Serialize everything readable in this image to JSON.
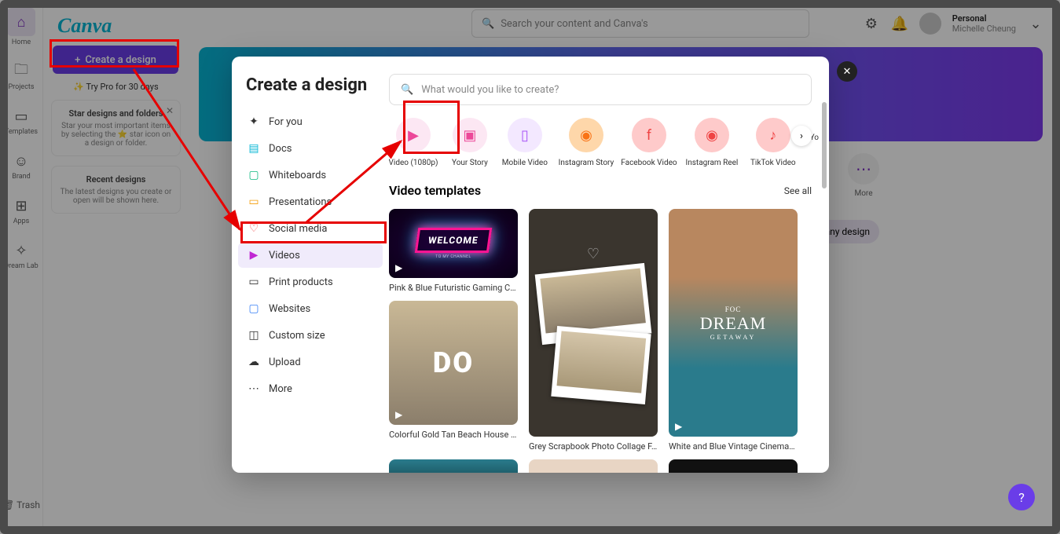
{
  "rail": {
    "items": [
      {
        "label": "Home",
        "icon": "⌂"
      },
      {
        "label": "Projects",
        "icon": "🗀"
      },
      {
        "label": "Templates",
        "icon": "▭"
      },
      {
        "label": "Brand",
        "icon": "☺"
      },
      {
        "label": "Apps",
        "icon": "⊞"
      },
      {
        "label": "Dream Lab",
        "icon": "✧"
      }
    ],
    "trash": "Trash"
  },
  "sidebar": {
    "logo": "Canva",
    "create_btn": "Create a design",
    "try_pro": "✨ Try Pro for 30 days",
    "card1_title": "Star designs and folders",
    "card1_text": "Star your most important items by selecting the ⭐ star icon on a design or folder.",
    "card2_title": "Recent designs",
    "card2_text": "The latest designs you create or open will be shown here."
  },
  "topbar": {
    "search_placeholder": "Search your content and Canva's",
    "personal": "Personal",
    "username": "Michelle Cheung"
  },
  "behind": {
    "more": "More",
    "any_design": "e any design"
  },
  "modal": {
    "title": "Create a design",
    "search_placeholder": "What would you like to create?",
    "categories": [
      {
        "label": "For you",
        "icon": "✦",
        "color": "#333"
      },
      {
        "label": "Docs",
        "icon": "▤",
        "color": "#06b6d4"
      },
      {
        "label": "Whiteboards",
        "icon": "▢",
        "color": "#10b981"
      },
      {
        "label": "Presentations",
        "icon": "▭",
        "color": "#f59e0b"
      },
      {
        "label": "Social media",
        "icon": "♡",
        "color": "#ef4444"
      },
      {
        "label": "Videos",
        "icon": "▶",
        "color": "#c026d3"
      },
      {
        "label": "Print products",
        "icon": "▭",
        "color": "#333"
      },
      {
        "label": "Websites",
        "icon": "▢",
        "color": "#3b82f6"
      },
      {
        "label": "Custom size",
        "icon": "◫",
        "color": "#333"
      },
      {
        "label": "Upload",
        "icon": "☁",
        "color": "#333"
      },
      {
        "label": "More",
        "icon": "⋯",
        "color": "#333"
      }
    ],
    "types": [
      {
        "label": "Video (1080p)",
        "bg": "#fce7f3",
        "fg": "#ec4899",
        "icon": "▶"
      },
      {
        "label": "Your Story",
        "bg": "#fce7f3",
        "fg": "#ec4899",
        "icon": "▣"
      },
      {
        "label": "Mobile Video",
        "bg": "#f3e8ff",
        "fg": "#a855f7",
        "icon": "▯"
      },
      {
        "label": "Instagram Story",
        "bg": "#fed7aa",
        "fg": "#f97316",
        "icon": "◉"
      },
      {
        "label": "Facebook Video",
        "bg": "#fecaca",
        "fg": "#ef4444",
        "icon": "f"
      },
      {
        "label": "Instagram Reel",
        "bg": "#fecaca",
        "fg": "#ef4444",
        "icon": "◉"
      },
      {
        "label": "TikTok Video",
        "bg": "#fecaca",
        "fg": "#ef4444",
        "icon": "♪"
      }
    ],
    "types_overflow": "Yo",
    "section_title": "Video templates",
    "see_all": "See all",
    "templates": [
      {
        "title": "Pink & Blue Futuristic Gaming Ch...",
        "welcome": "WELCOME",
        "sub": "TO MY CHANNEL"
      },
      {
        "title": "Colorful Gold Tan Beach House R...",
        "text": "DO"
      },
      {
        "title": "Grey Scrapbook Photo Collage F..."
      },
      {
        "title": "White and Blue Vintage Cinematic...",
        "t1": "FOC",
        "t2": "DREAM",
        "t3": "GETAWAY"
      }
    ]
  },
  "help": "?"
}
